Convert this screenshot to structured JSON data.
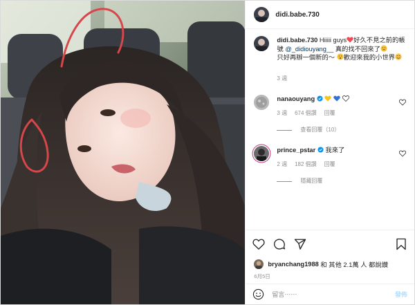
{
  "post": {
    "username": "didi.babe.730",
    "caption_text_1": "Hiiiii guys",
    "caption_text_2": "好久不見之前的帳號",
    "caption_mention": "@_didiouyang__",
    "caption_text_3": "真的找不回來了",
    "caption_text_4": "只好再辦一個新的～",
    "caption_text_5": "歡迎來我的小世界",
    "caption_time": "3 週"
  },
  "comments": [
    {
      "username": "nanaouyang",
      "time": "3 週",
      "likes": "674 個讚",
      "reply_label": "回覆",
      "replies_toggle": "查看回覆（10）"
    },
    {
      "username": "prince_pstar",
      "text": "我來了",
      "time": "2 週",
      "likes": "182 個讚",
      "reply_label": "回覆",
      "replies_toggle": "隱藏回覆"
    }
  ],
  "likes_line": {
    "user": "bryanchang1988",
    "rest": " 和 其他 2.1萬 人 都說讚"
  },
  "date": "6月5日",
  "add_comment": {
    "placeholder": "留言⋯⋯",
    "post_label": "發佈"
  },
  "colors": {
    "verified": "#0095f6",
    "heart_red": "#ed4956",
    "link": "#00376b",
    "muted": "#8e8e8e",
    "post_button": "#b2dffc"
  },
  "icons": [
    "heart-icon",
    "comment-icon",
    "share-icon",
    "bookmark-icon",
    "emoji-icon",
    "verified-icon"
  ]
}
